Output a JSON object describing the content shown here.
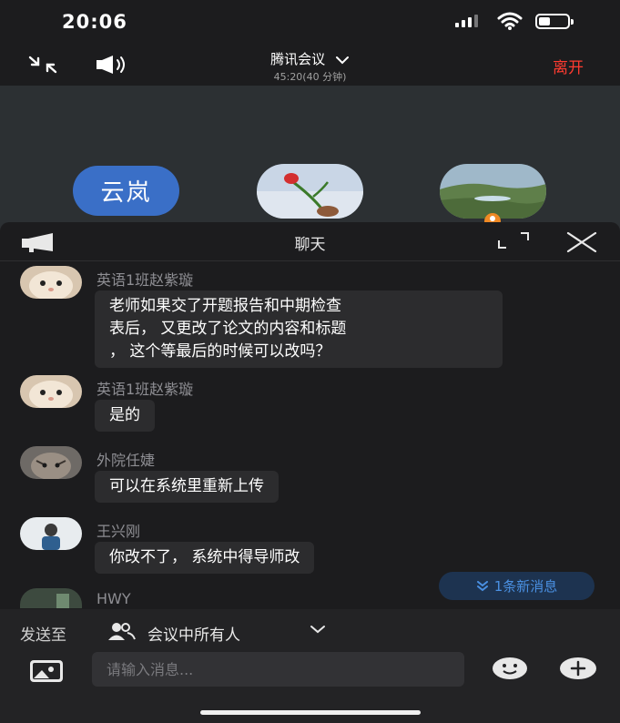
{
  "status_bar": {
    "time": "20:06"
  },
  "top_bar": {
    "meeting_title": "腾讯会议",
    "elapsed": "45:20(40 分钟)",
    "leave_label": "离开"
  },
  "video_tiles": [
    {
      "name": "云岚",
      "color": "#3a6fc7"
    },
    {
      "icon": "rose-avatar"
    },
    {
      "icon": "landscape-avatar"
    }
  ],
  "chat_panel": {
    "title": "聊天",
    "messages": [
      {
        "sender": "英语1班赵紫璇",
        "text_lines": [
          "老师如果交了开题报告和中期检查",
          "表后， 又更改了论文的内容和标题",
          "， 这个等最后的时候可以改吗？"
        ],
        "avatar": "cat-avatar"
      },
      {
        "sender": "英语1班赵紫璇",
        "text_lines": [
          "是的"
        ],
        "avatar": "cat-avatar"
      },
      {
        "sender": "外院任婕",
        "text_lines": [
          "可以在系统里重新上传"
        ],
        "avatar": "tabby-cat-avatar"
      },
      {
        "sender": "王兴刚",
        "text_lines": [
          "你改不了， 系统中得导师改"
        ],
        "avatar": "person-avatar"
      },
      {
        "sender": "HWY",
        "text_lines": [],
        "avatar": "photo-avatar"
      }
    ],
    "new_message_badge": "1条新消息"
  },
  "composer": {
    "send_to_label": "发送至",
    "send_to_target": "会议中所有人",
    "placeholder": "请输入消息..."
  },
  "colors": {
    "leave": "#ff3b30",
    "accent": "#4a90e2",
    "tile_blue": "#3a6fc7"
  }
}
